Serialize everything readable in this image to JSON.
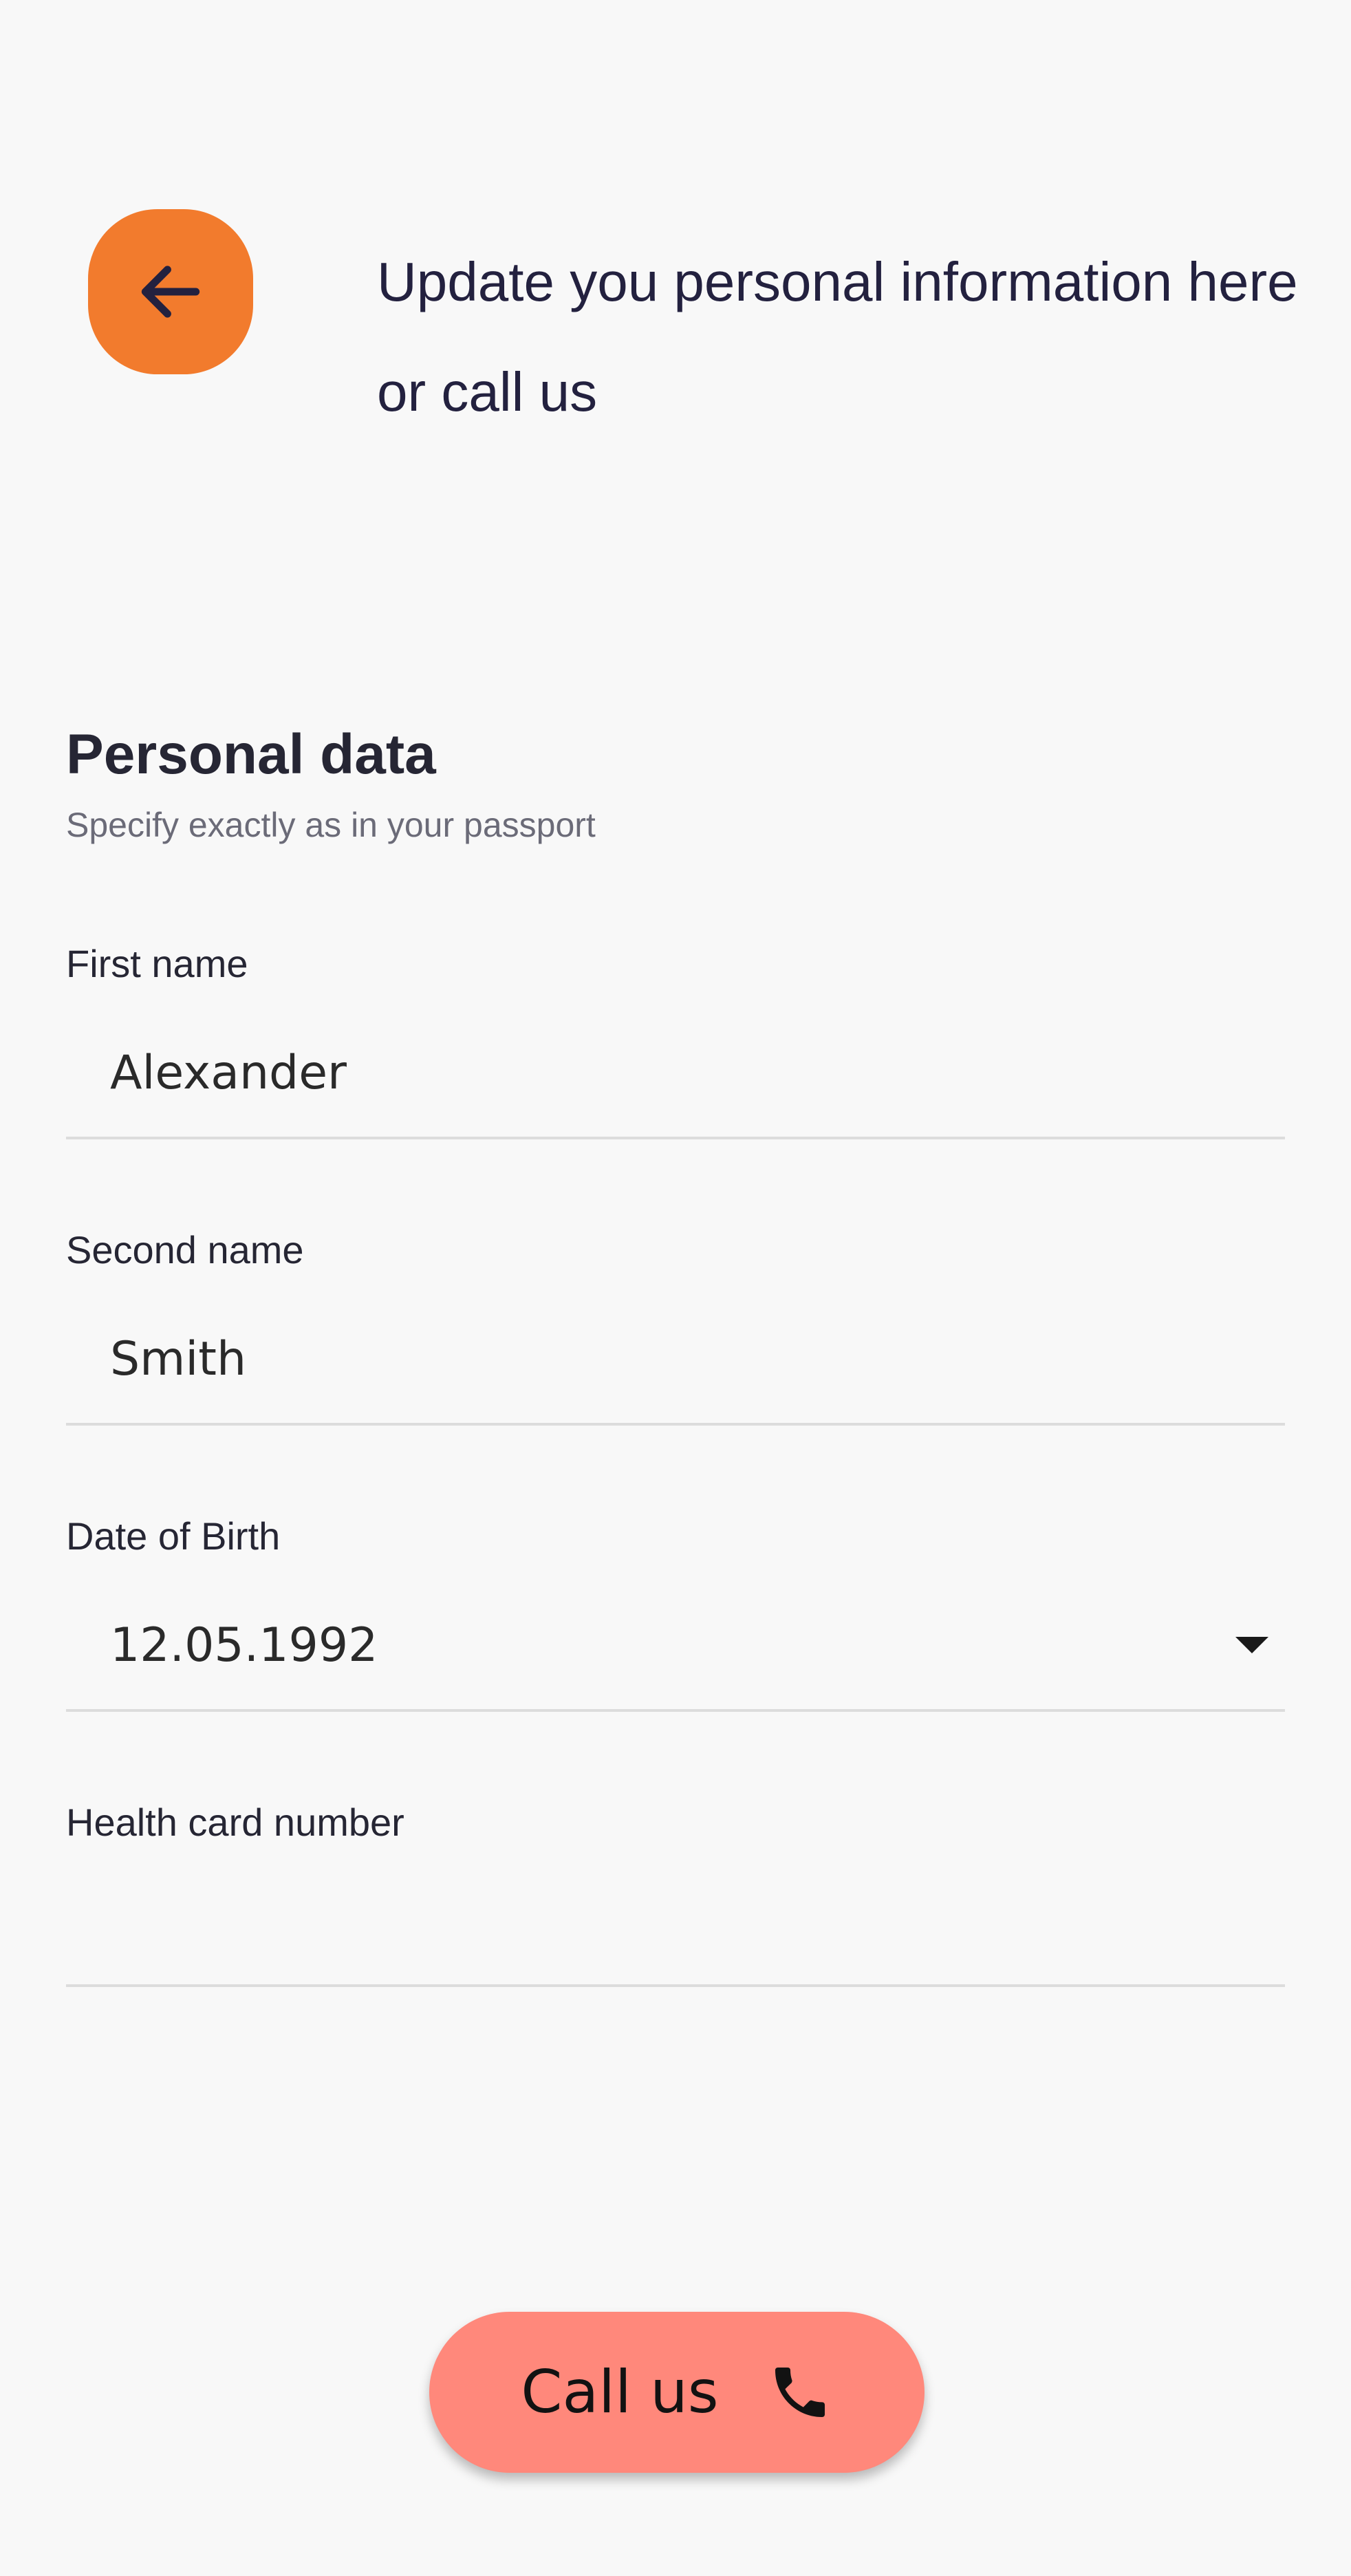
{
  "header": {
    "back_icon": "arrow-left-icon",
    "title": "Update you personal information here or call us"
  },
  "section": {
    "title": "Personal data",
    "subtitle": "Specify exactly as in your passport"
  },
  "fields": {
    "first_name": {
      "label": "First name",
      "value": "Alexander"
    },
    "second_name": {
      "label": "Second name",
      "value": "Smith"
    },
    "dob": {
      "label": "Date of Birth",
      "value": "12.05.1992",
      "icon": "dropdown-arrow-icon"
    },
    "health_card": {
      "label": "Health card number",
      "value": ""
    }
  },
  "call_button": {
    "label": "Call us",
    "icon": "phone-icon"
  },
  "colors": {
    "background": "#f8f8f8",
    "back_button": "#f27b2d",
    "call_button": "#ff887b",
    "title_text": "#23213f",
    "divider": "#dcdcdc"
  }
}
